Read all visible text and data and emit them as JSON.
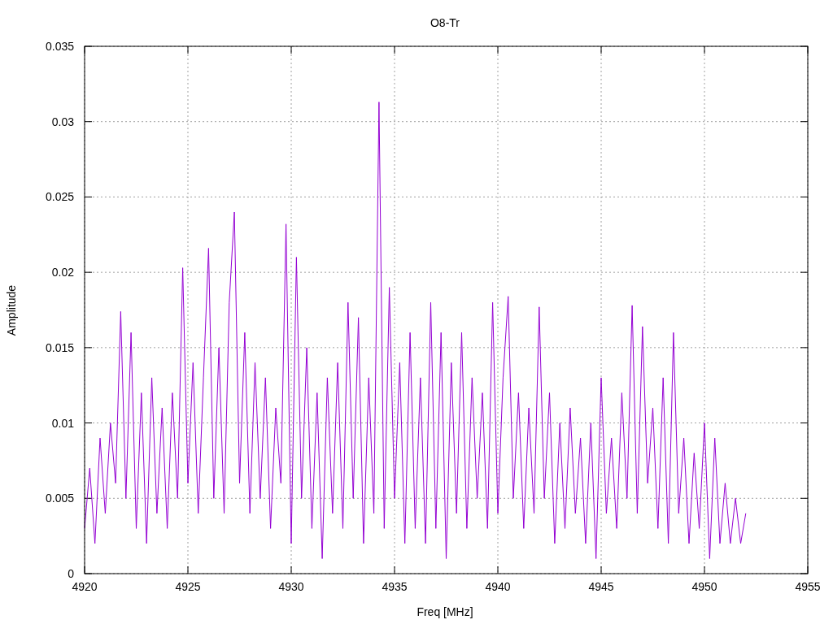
{
  "chart_data": {
    "type": "line",
    "title": "O8-Tr",
    "xlabel": "Freq [MHz]",
    "ylabel": "Amplitude",
    "xlim": [
      4920,
      4955
    ],
    "ylim": [
      0,
      0.035
    ],
    "xticks": [
      {
        "value": 4920,
        "label": "4920"
      },
      {
        "value": 4925,
        "label": "4925"
      },
      {
        "value": 4930,
        "label": "4930"
      },
      {
        "value": 4935,
        "label": "4935"
      },
      {
        "value": 4940,
        "label": "4940"
      },
      {
        "value": 4945,
        "label": "4945"
      },
      {
        "value": 4950,
        "label": "4950"
      },
      {
        "value": 4955,
        "label": "4955"
      }
    ],
    "yticks": [
      {
        "value": 0,
        "label": "0"
      },
      {
        "value": 0.005,
        "label": "0.005"
      },
      {
        "value": 0.01,
        "label": "0.01"
      },
      {
        "value": 0.015,
        "label": "0.015"
      },
      {
        "value": 0.02,
        "label": "0.02"
      },
      {
        "value": 0.025,
        "label": "0.025"
      },
      {
        "value": 0.03,
        "label": "0.03"
      },
      {
        "value": 0.035,
        "label": "0.035"
      }
    ],
    "x": [
      4920,
      4920.25,
      4920.5,
      4920.75,
      4921,
      4921.25,
      4921.5,
      4921.75,
      4922,
      4922.25,
      4922.5,
      4922.75,
      4923,
      4923.25,
      4923.5,
      4923.75,
      4924,
      4924.25,
      4924.5,
      4924.75,
      4925,
      4925.25,
      4925.5,
      4925.75,
      4926,
      4926.25,
      4926.5,
      4926.75,
      4927,
      4927.25,
      4927.5,
      4927.75,
      4928,
      4928.25,
      4928.5,
      4928.75,
      4929,
      4929.25,
      4929.5,
      4929.75,
      4930,
      4930.25,
      4930.5,
      4930.75,
      4931,
      4931.25,
      4931.5,
      4931.75,
      4932,
      4932.25,
      4932.5,
      4932.75,
      4933,
      4933.25,
      4933.5,
      4933.75,
      4934,
      4934.25,
      4934.5,
      4934.75,
      4935,
      4935.25,
      4935.5,
      4935.75,
      4936,
      4936.25,
      4936.5,
      4936.75,
      4937,
      4937.25,
      4937.5,
      4937.75,
      4938,
      4938.25,
      4938.5,
      4938.75,
      4939,
      4939.25,
      4939.5,
      4939.75,
      4940,
      4940.25,
      4940.5,
      4940.75,
      4941,
      4941.25,
      4941.5,
      4941.75,
      4942,
      4942.25,
      4942.5,
      4942.75,
      4943,
      4943.25,
      4943.5,
      4943.75,
      4944,
      4944.25,
      4944.5,
      4944.75,
      4945,
      4945.25,
      4945.5,
      4945.75,
      4946,
      4946.25,
      4946.5,
      4946.75,
      4947,
      4947.25,
      4947.5,
      4947.75,
      4948,
      4948.25,
      4948.5,
      4948.75,
      4949,
      4949.25,
      4949.5,
      4949.75,
      4950,
      4950.25,
      4950.5,
      4950.75,
      4951,
      4951.25,
      4951.5,
      4951.75,
      4952
    ],
    "grid": true,
    "series": [
      {
        "color": "#9400d3",
        "values": [
          0.003,
          0.007,
          0.002,
          0.009,
          0.004,
          0.01,
          0.006,
          0.0174,
          0.005,
          0.016,
          0.003,
          0.012,
          0.002,
          0.013,
          0.004,
          0.011,
          0.003,
          0.012,
          0.005,
          0.0203,
          0.006,
          0.014,
          0.004,
          0.013,
          0.0216,
          0.005,
          0.015,
          0.004,
          0.018,
          0.024,
          0.006,
          0.016,
          0.004,
          0.014,
          0.005,
          0.013,
          0.003,
          0.011,
          0.006,
          0.0232,
          0.002,
          0.021,
          0.005,
          0.015,
          0.003,
          0.012,
          0.001,
          0.013,
          0.004,
          0.014,
          0.003,
          0.018,
          0.005,
          0.017,
          0.002,
          0.013,
          0.004,
          0.0313,
          0.003,
          0.019,
          0.005,
          0.014,
          0.002,
          0.016,
          0.003,
          0.013,
          0.002,
          0.018,
          0.003,
          0.016,
          0.001,
          0.014,
          0.004,
          0.016,
          0.003,
          0.013,
          0.005,
          0.012,
          0.003,
          0.018,
          0.004,
          0.013,
          0.0184,
          0.005,
          0.012,
          0.003,
          0.011,
          0.004,
          0.0177,
          0.005,
          0.012,
          0.002,
          0.01,
          0.003,
          0.011,
          0.004,
          0.009,
          0.002,
          0.01,
          0.001,
          0.013,
          0.004,
          0.009,
          0.003,
          0.012,
          0.005,
          0.0178,
          0.004,
          0.0164,
          0.006,
          0.011,
          0.003,
          0.013,
          0.002,
          0.016,
          0.004,
          0.009,
          0.002,
          0.008,
          0.003,
          0.01,
          0.001,
          0.009,
          0.002,
          0.006,
          0.002,
          0.005,
          0.002,
          0.004
        ]
      }
    ]
  }
}
